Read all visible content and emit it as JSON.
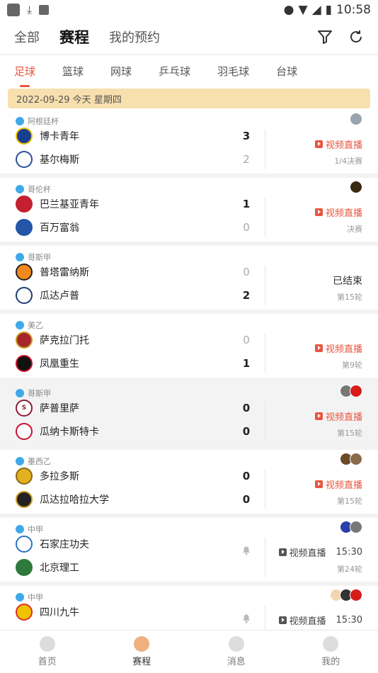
{
  "status_bar": {
    "time": "10:58"
  },
  "header": {
    "tabs": [
      "全部",
      "赛程",
      "我的预约"
    ],
    "active_tab": "赛程",
    "icons": [
      "filter-icon",
      "refresh-icon"
    ]
  },
  "sports_tabs": [
    "足球",
    "篮球",
    "网球",
    "乒乓球",
    "羽毛球",
    "台球"
  ],
  "date_header": "2022-09-29  今天  星期四",
  "live_label": "视频直播",
  "matches": [
    {
      "league": "阿根廷杯",
      "home": "博卡青年",
      "away": "基尔梅斯",
      "home_score": "3",
      "away_score": "2",
      "status": "live",
      "stage": "1/4决赛",
      "home_color": "#1a3f8f",
      "away_color": "#2b4d9a"
    },
    {
      "league": "哥伦杯",
      "home": "巴兰基亚青年",
      "away": "百万富翁",
      "home_score": "1",
      "away_score": "0",
      "status": "live",
      "stage": "决赛",
      "home_color": "#c3212f",
      "away_color": "#2355a8"
    },
    {
      "league": "哥斯甲",
      "home": "普塔雷纳斯",
      "away": "瓜达卢普",
      "home_score": "0",
      "away_score": "2",
      "status": "ended",
      "status_text": "已结束",
      "stage": "第15轮",
      "home_color": "#f08a1c",
      "away_color": "#1d3b73"
    },
    {
      "league": "美乙",
      "home": "萨克拉门托",
      "away": "凤凰重生",
      "home_score": "0",
      "away_score": "1",
      "status": "live",
      "stage": "第9轮",
      "home_color": "#a6262c",
      "away_color": "#c8102e"
    },
    {
      "league": "哥斯甲",
      "home": "萨普里萨",
      "away": "瓜纳卡斯特卡",
      "home_score": "0",
      "away_score": "0",
      "status": "live",
      "stage": "第15轮",
      "home_color": "#8a1c3a",
      "away_color": "#1f8a3c"
    },
    {
      "league": "墨西乙",
      "home": "多拉多斯",
      "away": "瓜达拉哈拉大学",
      "home_score": "0",
      "away_score": "0",
      "status": "live",
      "stage": "第15轮",
      "home_color": "#e2b020",
      "away_color": "#caa024"
    },
    {
      "league": "中甲",
      "home": "石家庄功夫",
      "away": "北京理工",
      "status": "scheduled",
      "time": "15:30",
      "stage": "第24轮",
      "home_color": "#2a72c4",
      "away_color": "#2d7a3a"
    },
    {
      "league": "中甲",
      "home": "四川九牛",
      "away": "",
      "status": "scheduled",
      "time": "15:30",
      "stage": "",
      "home_color": "#d8302a",
      "away_color": "#666666"
    }
  ],
  "bottom_nav": [
    "首页",
    "赛程",
    "消息",
    "我的"
  ],
  "colors": {
    "accent": "#e8553f",
    "date_bar": "#f7dfae"
  }
}
